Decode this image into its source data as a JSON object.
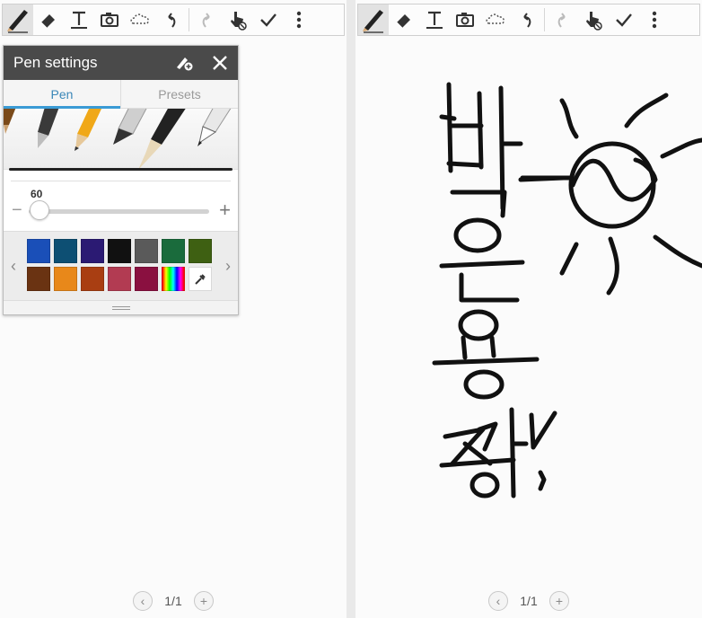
{
  "icons": {
    "pen": "pen-icon",
    "eraser": "eraser-icon",
    "text": "text-icon",
    "image": "camera-icon",
    "selection": "lasso-icon",
    "undo": "undo-icon",
    "redo": "redo-icon",
    "hand": "hand-touch-icon",
    "done": "check-icon",
    "more": "more-vertical-icon"
  },
  "pen_settings": {
    "title": "Pen settings",
    "tabs": [
      {
        "label": "Pen",
        "active": true
      },
      {
        "label": "Presets",
        "active": false
      }
    ],
    "size_value": "60",
    "size_percent": 60,
    "minus": "−",
    "plus": "+",
    "palette_prev": "‹",
    "palette_next": "›",
    "colors": [
      "#1a4fb8",
      "#0d4f73",
      "#2b1a73",
      "#111111",
      "#5a5a5a",
      "#1a6b3c",
      "#3e6012",
      "#6a3312",
      "#e8881a",
      "#a93e12",
      "#b23b52",
      "#8a1040",
      "spectrum",
      "eyedropper"
    ],
    "accent": "#3a9bd5"
  },
  "pager_left": {
    "label": "1/1",
    "prev": "‹",
    "add": "+"
  },
  "pager_right": {
    "label": "1/1",
    "prev": "‹",
    "add": "+"
  },
  "canvas": {
    "handwriting": "박은용 짱!",
    "drawing": "sun-doodle"
  }
}
